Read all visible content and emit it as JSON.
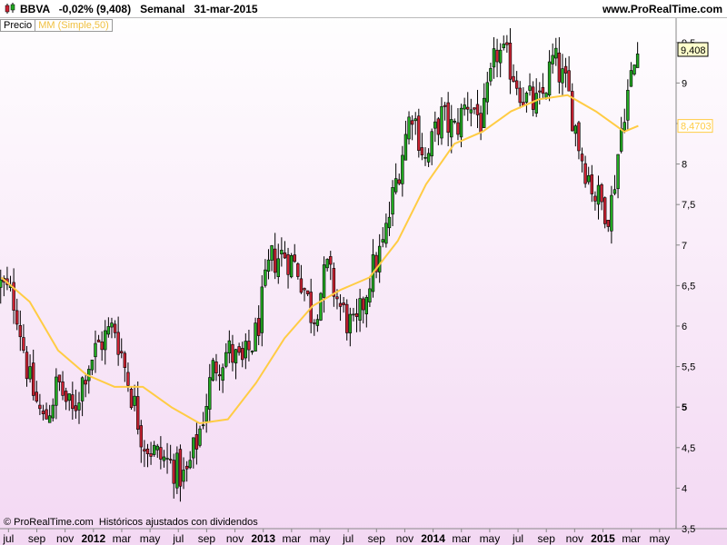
{
  "header": {
    "symbol": "BBVA",
    "change": "-0,02% (9,408)",
    "period": "Semanal",
    "date": "31-mar-2015",
    "site": "www.ProRealTime.com"
  },
  "legend": {
    "price_label": "Precio",
    "ma_label": "MM (Simple,50)"
  },
  "footer": {
    "copyright": "© ProRealTime.com  Históricos ajustados con dividendos"
  },
  "colors": {
    "background_top": "#ffffff",
    "background_bottom": "#f3d8f3",
    "candle_up": "#22aa22",
    "candle_down": "#cc2233",
    "moving_average": "#ffcc44"
  },
  "chart_data": {
    "type": "candlestick",
    "ylim": [
      3.5,
      9.8
    ],
    "y_ticks": [
      "3,5",
      "4",
      "4,5",
      "5",
      "5,5",
      "6",
      "6,5",
      "7",
      "7,5",
      "8",
      "8,5",
      "9",
      "9,5"
    ],
    "x_ticks": [
      "jul",
      "sep",
      "nov",
      "2012",
      "mar",
      "may",
      "jul",
      "sep",
      "nov",
      "2013",
      "mar",
      "may",
      "jul",
      "sep",
      "nov",
      "2014",
      "mar",
      "may",
      "jul",
      "sep",
      "nov",
      "2015",
      "mar",
      "may"
    ],
    "last_price_label": "9,408",
    "ma_value_label": "8,4703",
    "series": [
      {
        "name": "Precio",
        "close_points": [
          {
            "x": "2011-06",
            "y": 6.5
          },
          {
            "x": "2011-07",
            "y": 6.3
          },
          {
            "x": "2011-08",
            "y": 5.3
          },
          {
            "x": "2011-09",
            "y": 4.8
          },
          {
            "x": "2011-10",
            "y": 5.3
          },
          {
            "x": "2011-11",
            "y": 4.9
          },
          {
            "x": "2011-12",
            "y": 5.5
          },
          {
            "x": "2012-01",
            "y": 5.8
          },
          {
            "x": "2012-02",
            "y": 6.0
          },
          {
            "x": "2012-03",
            "y": 5.3
          },
          {
            "x": "2012-04",
            "y": 4.6
          },
          {
            "x": "2012-05",
            "y": 4.4
          },
          {
            "x": "2012-06",
            "y": 4.3
          },
          {
            "x": "2012-07",
            "y": 4.1
          },
          {
            "x": "2012-08",
            "y": 4.7
          },
          {
            "x": "2012-09",
            "y": 5.5
          },
          {
            "x": "2012-10",
            "y": 5.7
          },
          {
            "x": "2012-11",
            "y": 5.5
          },
          {
            "x": "2012-12",
            "y": 5.9
          },
          {
            "x": "2013-01",
            "y": 6.8
          },
          {
            "x": "2013-02",
            "y": 6.9
          },
          {
            "x": "2013-03",
            "y": 6.7
          },
          {
            "x": "2013-04",
            "y": 6.1
          },
          {
            "x": "2013-05",
            "y": 6.7
          },
          {
            "x": "2013-06",
            "y": 6.2
          },
          {
            "x": "2013-07",
            "y": 5.9
          },
          {
            "x": "2013-08",
            "y": 6.6
          },
          {
            "x": "2013-09",
            "y": 7.0
          },
          {
            "x": "2013-10",
            "y": 7.9
          },
          {
            "x": "2013-11",
            "y": 8.7
          },
          {
            "x": "2013-12",
            "y": 8.0
          },
          {
            "x": "2014-01",
            "y": 8.6
          },
          {
            "x": "2014-02",
            "y": 8.4
          },
          {
            "x": "2014-03",
            "y": 8.8
          },
          {
            "x": "2014-04",
            "y": 8.5
          },
          {
            "x": "2014-05",
            "y": 9.4
          },
          {
            "x": "2014-06",
            "y": 9.2
          },
          {
            "x": "2014-07",
            "y": 8.8
          },
          {
            "x": "2014-08",
            "y": 8.7
          },
          {
            "x": "2014-09",
            "y": 9.3
          },
          {
            "x": "2014-10",
            "y": 8.9
          },
          {
            "x": "2014-11",
            "y": 8.1
          },
          {
            "x": "2014-12",
            "y": 7.6
          },
          {
            "x": "2015-01",
            "y": 7.4
          },
          {
            "x": "2015-02",
            "y": 8.7
          },
          {
            "x": "2015-03",
            "y": 9.408
          }
        ]
      },
      {
        "name": "MM (Simple,50)",
        "points": [
          {
            "x": "2011-06",
            "y": 6.6
          },
          {
            "x": "2011-08",
            "y": 6.3
          },
          {
            "x": "2011-10",
            "y": 5.7
          },
          {
            "x": "2011-12",
            "y": 5.4
          },
          {
            "x": "2012-02",
            "y": 5.25
          },
          {
            "x": "2012-04",
            "y": 5.25
          },
          {
            "x": "2012-06",
            "y": 5.0
          },
          {
            "x": "2012-08",
            "y": 4.8
          },
          {
            "x": "2012-10",
            "y": 4.85
          },
          {
            "x": "2012-12",
            "y": 5.3
          },
          {
            "x": "2013-02",
            "y": 5.85
          },
          {
            "x": "2013-04",
            "y": 6.25
          },
          {
            "x": "2013-06",
            "y": 6.45
          },
          {
            "x": "2013-08",
            "y": 6.6
          },
          {
            "x": "2013-10",
            "y": 7.05
          },
          {
            "x": "2013-12",
            "y": 7.75
          },
          {
            "x": "2014-02",
            "y": 8.25
          },
          {
            "x": "2014-04",
            "y": 8.4
          },
          {
            "x": "2014-06",
            "y": 8.65
          },
          {
            "x": "2014-08",
            "y": 8.8
          },
          {
            "x": "2014-10",
            "y": 8.85
          },
          {
            "x": "2014-12",
            "y": 8.65
          },
          {
            "x": "2015-02",
            "y": 8.4
          },
          {
            "x": "2015-03",
            "y": 8.47
          }
        ]
      }
    ]
  }
}
